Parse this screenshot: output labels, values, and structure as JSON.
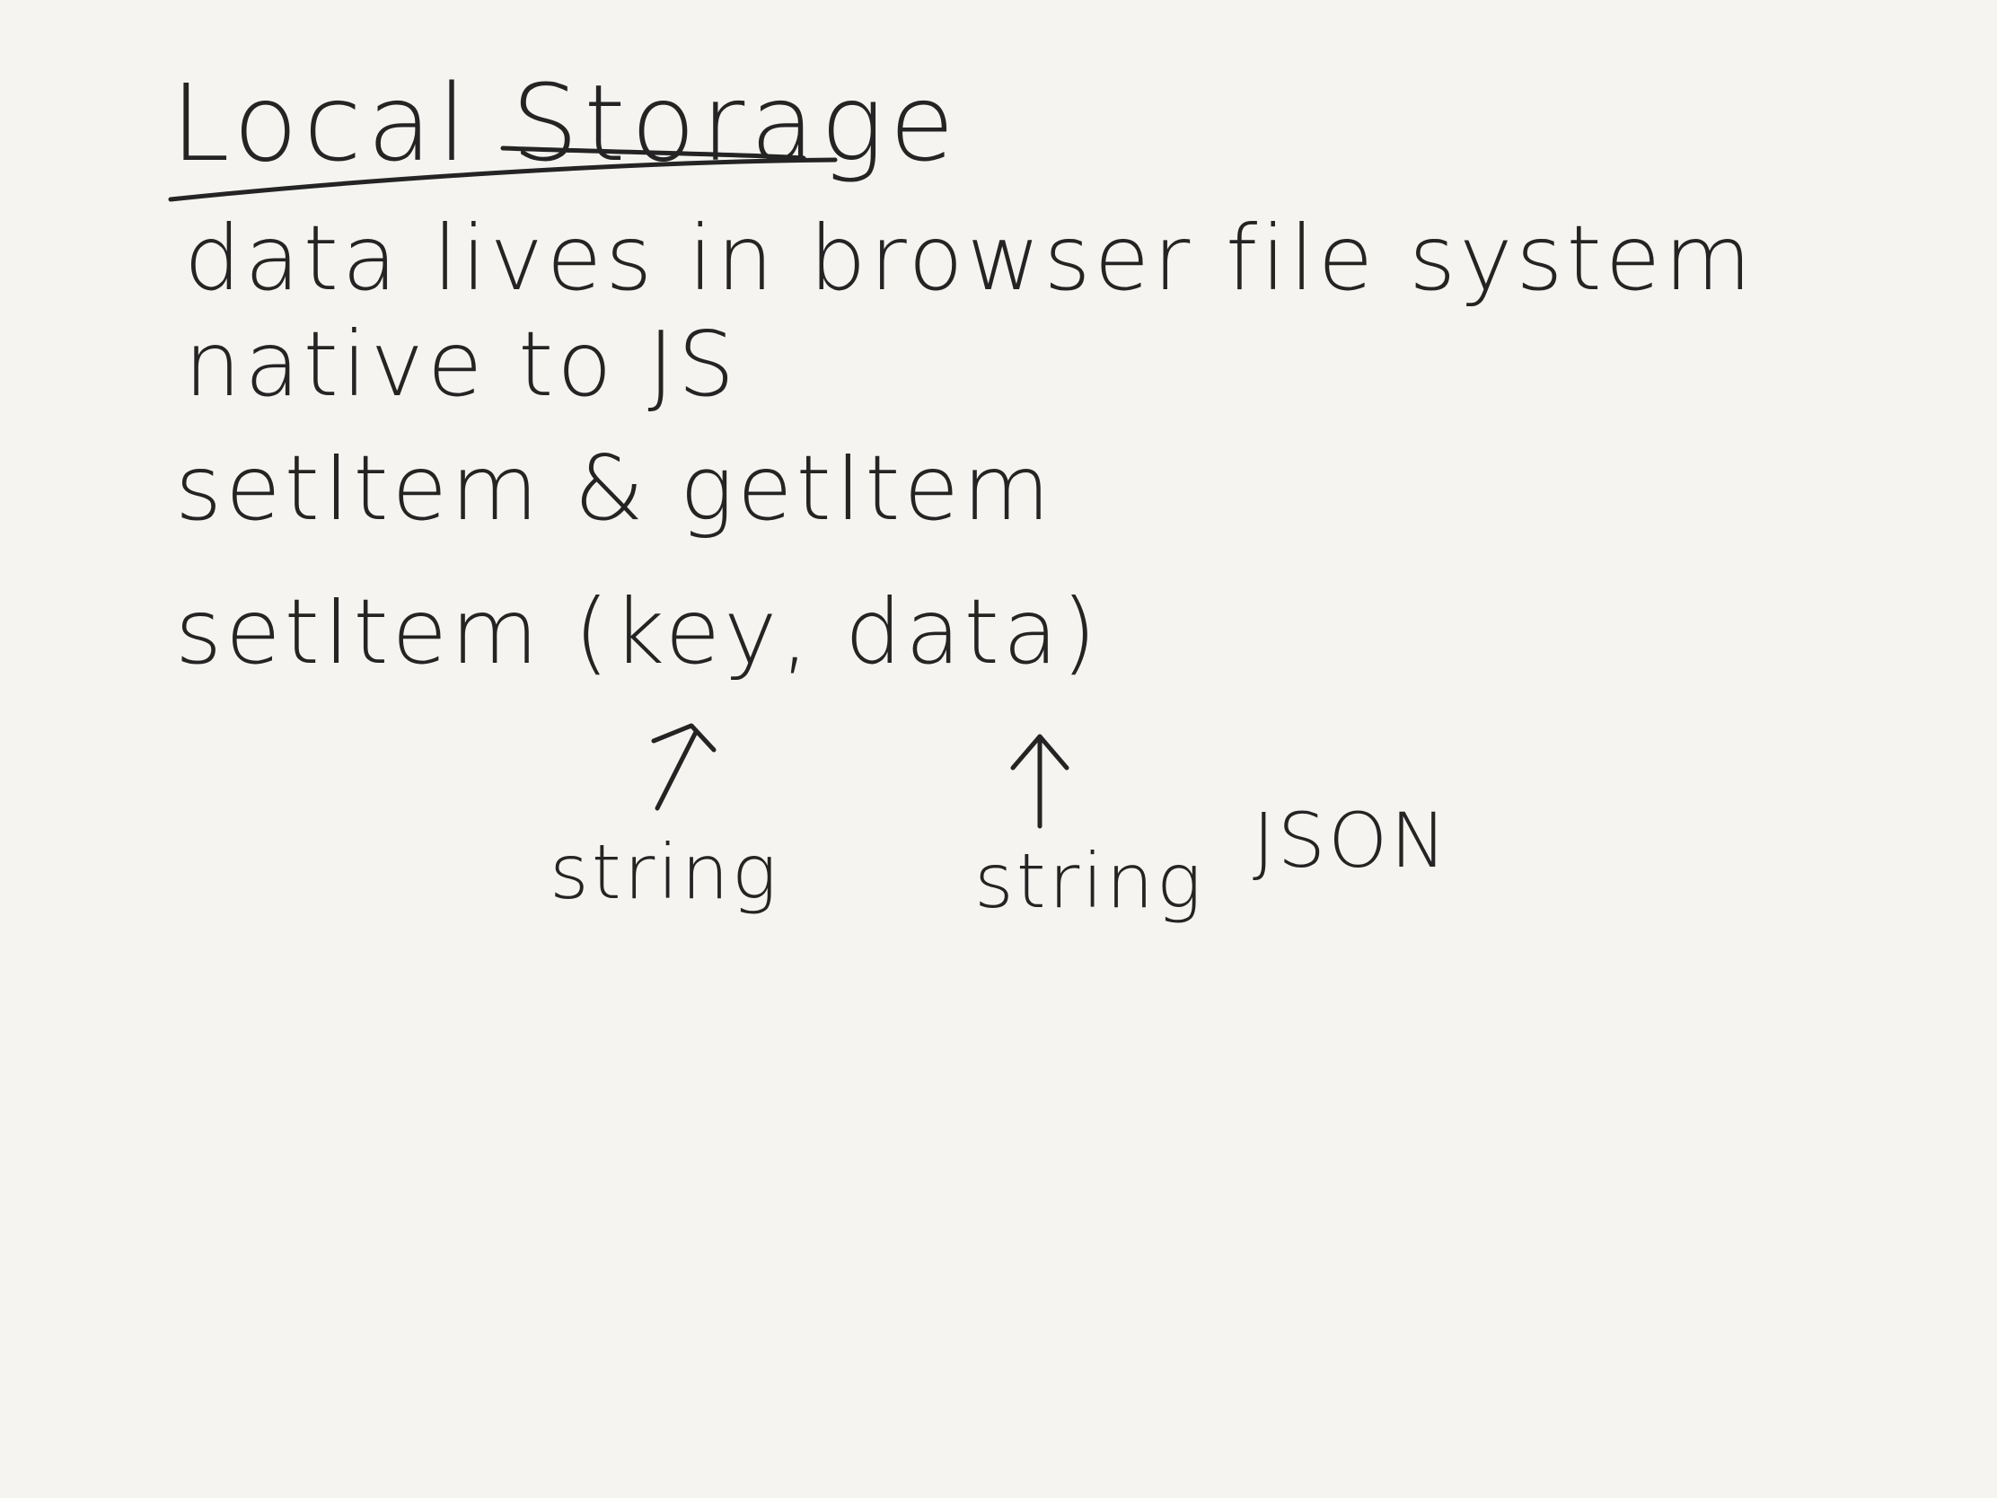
{
  "note": {
    "title": "Local Storage",
    "lines": [
      "data lives in browser file system",
      "native to JS",
      "setItem & getItem",
      "setItem (key, data)"
    ],
    "annotations": {
      "key_type": "string",
      "data_type_1": "string",
      "data_type_2": "JSON"
    }
  },
  "colors": {
    "paper": "#f5f4f0",
    "ink": "#242424"
  }
}
